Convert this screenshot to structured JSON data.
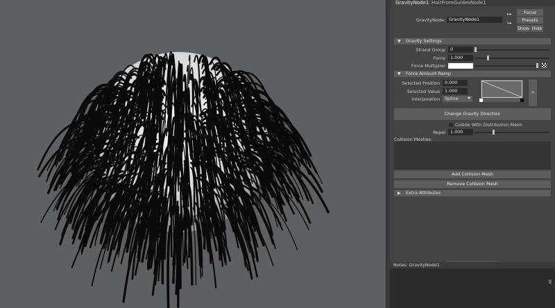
{
  "tabs": [
    {
      "label": "GravityNode1",
      "active": true
    },
    {
      "label": "HairFromGuidesNode1",
      "active": false
    }
  ],
  "node": {
    "label": "GravityNode:",
    "value": "GravityNode1"
  },
  "buttons": {
    "focus": "Focus",
    "presets": "Presets",
    "show": "Show",
    "hide": "Hide"
  },
  "gravity_settings": {
    "title": "Gravity Settings",
    "strand_group_label": "Strand Group",
    "strand_group_value": "0",
    "strand_group_slider": 0.0,
    "force_label": "Force",
    "force_value": "1.000",
    "force_slider": 0.17,
    "force_multiplier_label": "Force Multiplier",
    "force_multiplier_color": "#ffffff"
  },
  "force_amount_ramp": {
    "title": "Force Amount Ramp",
    "selected_position_label": "Selected Position",
    "selected_position_value": "0.000",
    "selected_value_label": "Selected Value",
    "selected_value_value": "1.000",
    "interpolation_label": "Interpolation",
    "interpolation_value": "Spline",
    "expand_glyph": ">"
  },
  "change_gravity_button": "Change Gravity Direction",
  "collide": {
    "label": "Collide With Distribution Mesh",
    "checked": false
  },
  "repel": {
    "label": "Repel",
    "value": "1.000",
    "slider": 0.25
  },
  "collision": {
    "meshes_label": "Collision Meshes:",
    "add_button": "Add Collision Mesh",
    "remove_button": "Remove Collision Mesh"
  },
  "extra_attributes": "Extra Attributes",
  "notes": {
    "label": "Notes:",
    "node": "GravityNode1"
  },
  "colors": {
    "viewport_bg": "#5c6062",
    "panel_bg": "#444444",
    "field_bg": "#2b2b2b",
    "button_bg": "#5d5d5d",
    "hair": "#0a0a0a"
  }
}
